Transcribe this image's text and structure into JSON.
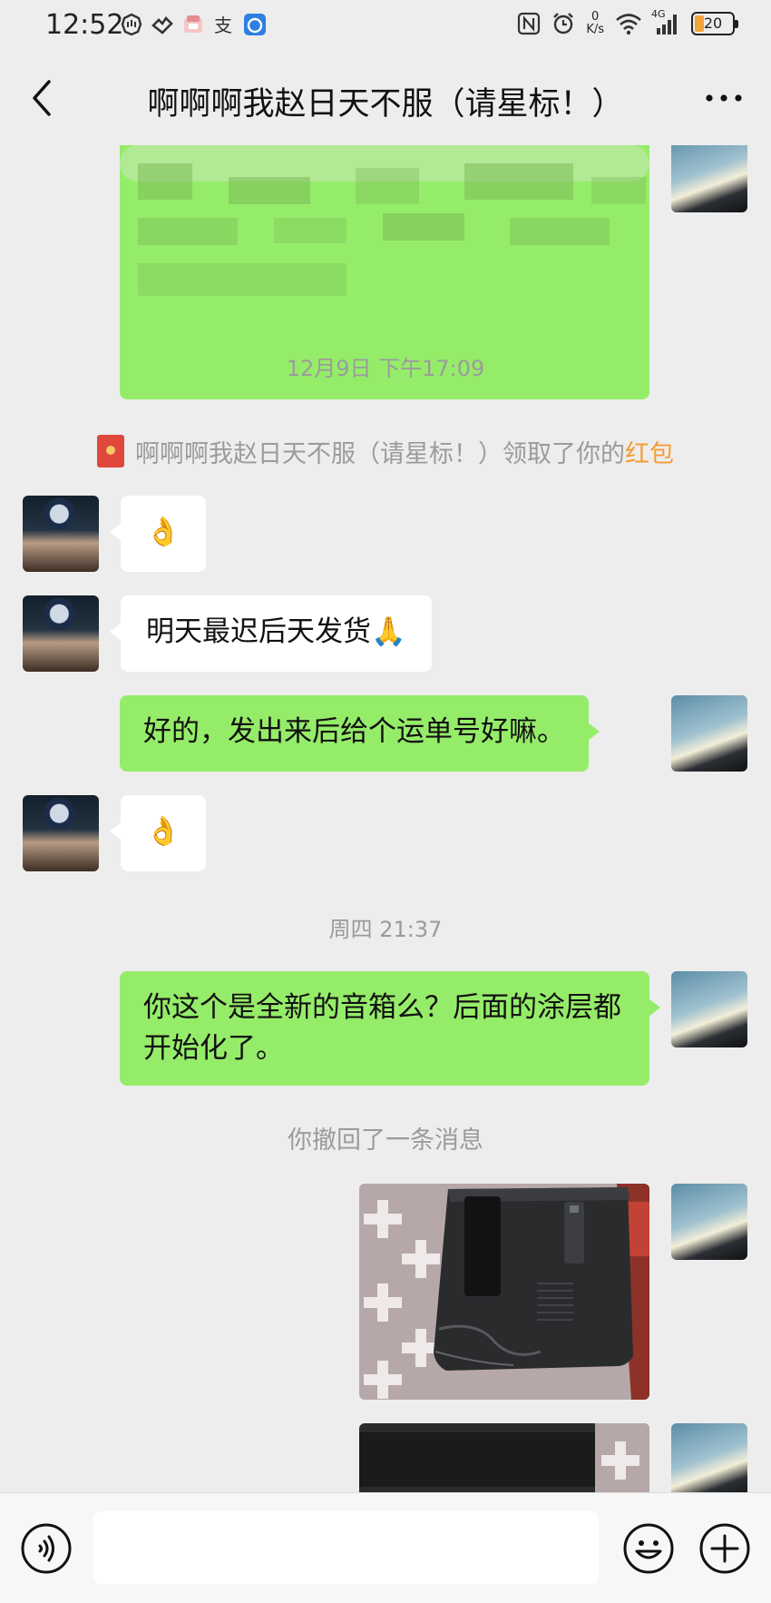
{
  "status_bar": {
    "time": "12:52",
    "net_speed_value": "0",
    "net_speed_unit": "K/s",
    "signal_label": "4G",
    "battery": "20",
    "icons": [
      "hand-icon",
      "heart-app-icon",
      "box-app-icon",
      "alipay-icon",
      "app-icon",
      "nfc-icon",
      "alarm-icon",
      "wifi-icon",
      "signal-icon",
      "battery-icon"
    ]
  },
  "header": {
    "back_icon": "chevron-left-icon",
    "title": "啊啊啊我赵日天不服（请星标！）",
    "more_icon": "more-icon"
  },
  "messages": {
    "time_1": "12月9日 下午17:09",
    "red_packet_notice": "啊啊啊我赵日天不服（请星标！）领取了你的",
    "red_packet_link": "红包",
    "ok_emoji_1": "👌",
    "m2": "明天最迟后天发货",
    "m3": "好的，发出来后给个运单号好嘛。",
    "ok_emoji_2": "👌",
    "time_2": "周四 21:37",
    "m5": "你这个是全新的音箱么？后面的涂层都开始化了。",
    "recall": "你撤回了一条消息"
  },
  "input_bar": {
    "voice_icon": "voice-icon",
    "emoji_icon": "emoji-icon",
    "plus_icon": "plus-icon",
    "placeholder": ""
  },
  "colors": {
    "background": "#ededed",
    "my_bubble": "#95ec69",
    "other_bubble": "#ffffff",
    "link": "#f39c32",
    "system_text": "#9b9b9b"
  }
}
